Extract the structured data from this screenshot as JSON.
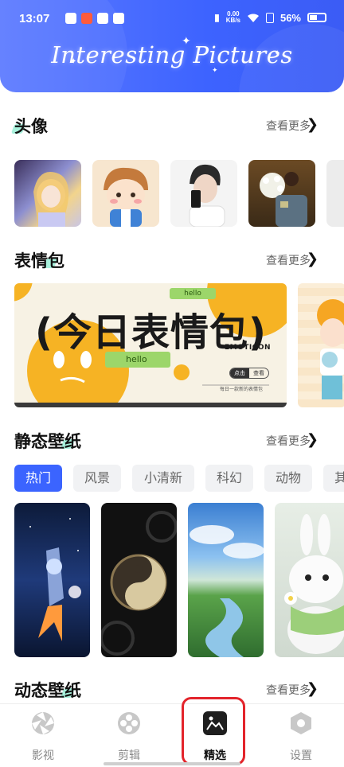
{
  "status_bar": {
    "time": "13:07",
    "net_speed_value": "0.00",
    "net_speed_unit": "KB/s",
    "battery": "56%"
  },
  "header": {
    "title": "Interesting Pictures"
  },
  "sections": {
    "avatar": {
      "title": "头像",
      "more": "查看更多"
    },
    "stickers": {
      "title": "表情包",
      "more": "查看更多"
    },
    "static_wallpaper": {
      "title": "静态壁纸",
      "more": "查看更多"
    },
    "live_wallpaper": {
      "title": "动态壁纸",
      "more": "查看更多"
    }
  },
  "sticker_banner": {
    "headline": "(今日表情包)",
    "tag_top": "hello",
    "tag_bottom": "hello",
    "emoticon": "EMOTICON",
    "click_label": "点击",
    "view_label": "查看",
    "subtitle": "每日一款新的表情包"
  },
  "wallpaper_chips": [
    {
      "label": "热门",
      "active": true
    },
    {
      "label": "风景",
      "active": false
    },
    {
      "label": "小清新",
      "active": false
    },
    {
      "label": "科幻",
      "active": false
    },
    {
      "label": "动物",
      "active": false
    },
    {
      "label": "其",
      "active": false
    }
  ],
  "bottom_nav": [
    {
      "label": "影视",
      "icon": "aperture-icon",
      "active": false
    },
    {
      "label": "剪辑",
      "icon": "film-reel-icon",
      "active": false
    },
    {
      "label": "精选",
      "icon": "image-gallery-icon",
      "active": true
    },
    {
      "label": "设置",
      "icon": "hexagon-settings-icon",
      "active": false
    }
  ],
  "colors": {
    "accent": "#3b64ff",
    "header": "#4a6cff",
    "highlight_mark": "#9ef0d8",
    "focus_outline": "#e3242b"
  }
}
